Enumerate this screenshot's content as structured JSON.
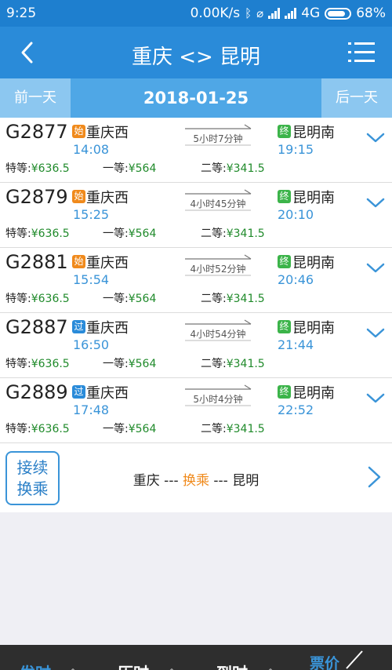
{
  "status": {
    "time": "9:25",
    "speed": "0.00K/s",
    "network": "4G",
    "battery": "68%"
  },
  "header": {
    "title": "重庆 <> 昆明",
    "back_icon": "back-arrow-icon",
    "menu_icon": "list-menu-icon"
  },
  "date_bar": {
    "prev_label": "前一天",
    "date": "2018-01-25",
    "next_label": "后一天"
  },
  "trains": [
    {
      "number": "G2877",
      "from_tag": "始",
      "from_station": "重庆西",
      "depart": "14:08",
      "duration": "5小时7分钟",
      "to_tag": "终",
      "to_station": "昆明南",
      "arrive": "19:15",
      "business_label": "特等:",
      "business_price": "¥636.5",
      "first_label": "一等:",
      "first_price": "¥564",
      "second_label": "二等:",
      "second_price": "¥341.5"
    },
    {
      "number": "G2879",
      "from_tag": "始",
      "from_station": "重庆西",
      "depart": "15:25",
      "duration": "4小时45分钟",
      "to_tag": "终",
      "to_station": "昆明南",
      "arrive": "20:10",
      "business_label": "特等:",
      "business_price": "¥636.5",
      "first_label": "一等:",
      "first_price": "¥564",
      "second_label": "二等:",
      "second_price": "¥341.5"
    },
    {
      "number": "G2881",
      "from_tag": "始",
      "from_station": "重庆西",
      "depart": "15:54",
      "duration": "4小时52分钟",
      "to_tag": "终",
      "to_station": "昆明南",
      "arrive": "20:46",
      "business_label": "特等:",
      "business_price": "¥636.5",
      "first_label": "一等:",
      "first_price": "¥564",
      "second_label": "二等:",
      "second_price": "¥341.5"
    },
    {
      "number": "G2887",
      "from_tag": "过",
      "from_station": "重庆西",
      "depart": "16:50",
      "duration": "4小时54分钟",
      "to_tag": "终",
      "to_station": "昆明南",
      "arrive": "21:44",
      "business_label": "特等:",
      "business_price": "¥636.5",
      "first_label": "一等:",
      "first_price": "¥564",
      "second_label": "二等:",
      "second_price": "¥341.5"
    },
    {
      "number": "G2889",
      "from_tag": "过",
      "from_station": "重庆西",
      "depart": "17:48",
      "duration": "5小时4分钟",
      "to_tag": "终",
      "to_station": "昆明南",
      "arrive": "22:52",
      "business_label": "特等:",
      "business_price": "¥636.5",
      "first_label": "一等:",
      "first_price": "¥564",
      "second_label": "二等:",
      "second_price": "¥341.5"
    }
  ],
  "transfer": {
    "button_line1": "接续",
    "button_line2": "换乘",
    "from": "重庆",
    "sep1": " --- ",
    "middle": "换乘",
    "sep2": " --- ",
    "to": "昆明"
  },
  "sort_bar": {
    "depart": "发时",
    "duration": "历时",
    "arrive": "到时",
    "price": "票价"
  },
  "colors": {
    "primary": "#2a8bd9",
    "status_bar": "#1e7fcf",
    "date_bar": "#4fa7e6",
    "tag_origin": "#f08a1c",
    "tag_pass": "#2a8bd9",
    "tag_terminal": "#3cb44a",
    "price_green": "#1f8a2a",
    "highlight_orange": "#f08a1c"
  }
}
